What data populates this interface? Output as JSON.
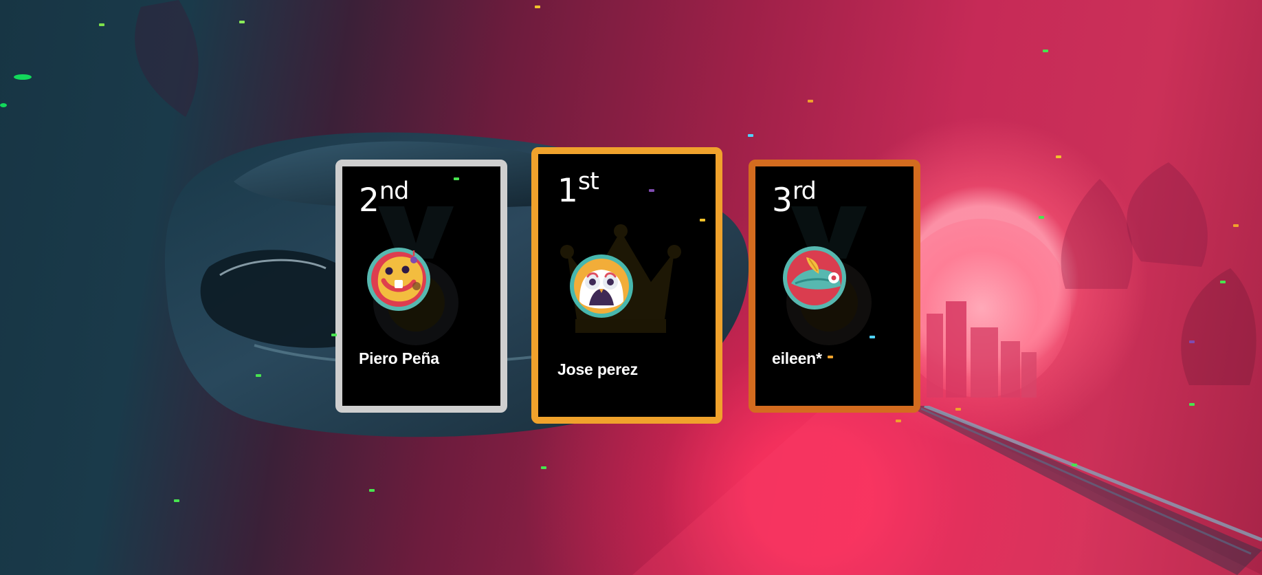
{
  "podium": {
    "players": [
      {
        "place": "2",
        "suffix": "nd",
        "name": "Piero Peña",
        "avatar": "smiling-blob-avatar",
        "frame_color": "#cfcfcf",
        "watermark": "medal-icon"
      },
      {
        "place": "1",
        "suffix": "st",
        "name": "Jose perez",
        "avatar": "owl-avatar",
        "frame_color": "#f0a22c",
        "watermark": "crown-icon"
      },
      {
        "place": "3",
        "suffix": "rd",
        "name": "eileen*",
        "avatar": "feather-hat-avatar",
        "frame_color": "#d46c1f",
        "watermark": "medal-icon"
      }
    ]
  },
  "theme": {
    "background": "synthwave-car-scene",
    "accent_pink": "#c62a57",
    "accent_blue": "#173544"
  }
}
